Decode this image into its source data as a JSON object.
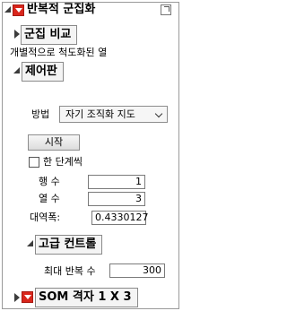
{
  "header": {
    "title": "반복적 군집화"
  },
  "cluster_compare": {
    "title": "군집 비교",
    "note": "개별적으로 척도화된 열"
  },
  "control_panel": {
    "title": "제어판",
    "method_label": "방법",
    "method_value": "자기 조직화 지도",
    "start_button": "시작",
    "single_step_label": "한 단계씩",
    "single_step_checked": false,
    "rows_label": "행 수",
    "rows_value": "1",
    "cols_label": "열 수",
    "cols_value": "3",
    "bandwidth_label": "대역폭:",
    "bandwidth_value": "0.4330127"
  },
  "advanced": {
    "title": "고급 컨트롤",
    "max_iter_label": "최대 반복 수",
    "max_iter_value": "300"
  },
  "som_grid": {
    "title": "SOM 격자 1 X 3"
  },
  "icons": {
    "collapse": "triangle-down-icon",
    "expand": "triangle-right-icon",
    "menu": "red-menu-icon",
    "corner": "panel-options-icon"
  },
  "colors": {
    "menu_red": "#d9261c",
    "border": "#8a8a8a"
  }
}
